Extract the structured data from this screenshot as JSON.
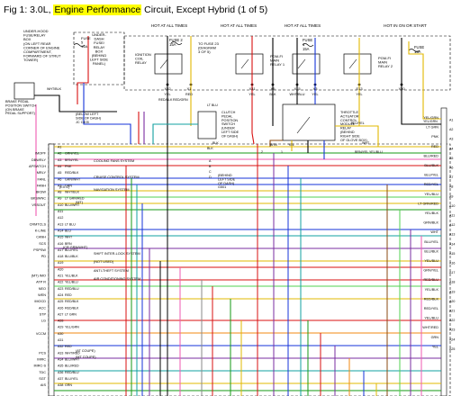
{
  "figure": {
    "title_prefix": "Fig 1: 3.0L, ",
    "title_highlight": "Engine Performance",
    "title_suffix": " Circuit, Except Hybrid (1 of 5)",
    "highlight_color": "#ffff00"
  },
  "power": {
    "hot_labels": [
      "HOT AT ALL TIMES",
      "HOT AT ALL TIMES",
      "HOT AT ALL TIMES",
      "HOT IN ON OR START"
    ],
    "fuse_box_underhood": [
      "UNDER-HOOD",
      "FUSE/RELAY",
      "BOX",
      "(ON LEFT REAR",
      "CORNER OF ENGINE",
      "COMPARTMENT,",
      "FORWARD OF STRUT",
      "TOWER)"
    ],
    "fuse_box_dash": [
      "UNDER-",
      "DASH",
      "FUSE/",
      "RELAY",
      "BOX",
      "(BEHIND",
      "LEFT SIDE",
      "PANEL)"
    ],
    "fuse5": [
      "FUSE",
      "5",
      "15A"
    ],
    "fuse2": [
      "FUSE 2",
      "15A"
    ],
    "fuse23": [
      "TO FUSE 23",
      "(DIAGRAM",
      "3 OF 5)"
    ],
    "fuse1": [
      "FUSE",
      "1",
      "15A"
    ],
    "fuse": [
      "FUSE",
      "15A"
    ],
    "ignition_coil_relay": [
      "IGNITION",
      "COIL",
      "RELAY"
    ],
    "pgm_fi_relay_1": [
      "PGM-FI",
      "MAIN",
      "RELAY 1"
    ],
    "pgm_fi_relay_2": [
      "PGM-FI",
      "MAIN",
      "RELAY 2"
    ]
  },
  "connectors": [
    {
      "pin": "X32",
      "wire": "YEL"
    },
    {
      "pin": "X1",
      "wire": "RED"
    },
    {
      "pin": "X31",
      "wire": "YEL"
    },
    {
      "pin": "X5",
      "wire": "BLK"
    },
    {
      "pin": "X15",
      "wire": "WHT/BLU"
    },
    {
      "pin": "X3",
      "wire": "YEL"
    },
    {
      "pin": "E13",
      "wire": "YEL"
    },
    {
      "pin": "X30",
      "wire": ""
    }
  ],
  "relays": {
    "brake_switch": [
      "BRAKE PEDAL",
      "POSITION SWITCH",
      "(ON BRAKE",
      "PEDAL SUPPORT)"
    ],
    "below_dash": [
      "(BELOW LEFT",
      "SIDE OF DASH)",
      "JC C405"
    ],
    "clutch_switch": [
      "CLUTCH",
      "PEDAL",
      "POSITION",
      "SWITCH",
      "(UNDER",
      "LEFT SIDE",
      "OF DASH)"
    ],
    "throttle_relay": [
      "THROTTLE",
      "ACTUATOR",
      "CONTROL",
      "MODULE",
      "RELAY",
      "(BEHIND",
      "RIGHT SIDE",
      "OF GLOVE BOX)"
    ],
    "ground": [
      "(BEHIND",
      "LEFT SIDE",
      "OF DASH)",
      "G501"
    ],
    "misc": [
      "LT BLU",
      "BLK",
      "BLU/YEL",
      "YEL/GRN",
      "WHT/BLK",
      "2",
      "1",
      "A",
      "B",
      "C",
      "D",
      "RED/BLK",
      "RED/GRN",
      "BRN",
      "YEL",
      "BLK",
      "WHT",
      "BRN/YEL",
      "YEL/BLU"
    ]
  },
  "ecm_left": [
    {
      "pin": "A1",
      "wire": "",
      "signal": ""
    },
    {
      "pin": "A2",
      "wire": "GRN/YEL",
      "signal": "IMOPF"
    },
    {
      "pin": "A3",
      "wire": "BRN/YEL",
      "signal": "DBWRLY"
    },
    {
      "pin": "A4",
      "wire": "PNK",
      "signal": "APSWTCH"
    },
    {
      "pin": "A5",
      "wire": "RED/BLK",
      "signal": "MRLY"
    },
    {
      "pin": "A6",
      "wire": "GRN/WHT",
      "signal": "FANL"
    },
    {
      "pin": "A7",
      "wire": "GRN",
      "signal": "FANH"
    },
    {
      "pin": "A8",
      "wire": "WHT/BLK",
      "signal": "BKSW"
    },
    {
      "pin": "A9",
      "wire": "LT GRN/RED",
      "signal": "BKSWNC"
    },
    {
      "pin": "A10",
      "wire": "BLU/WHT",
      "signal": "VSSOUT"
    },
    {
      "pin": "A11",
      "wire": "",
      "signal": ""
    },
    {
      "pin": "A12",
      "wire": "",
      "signal": ""
    },
    {
      "pin": "A13",
      "wire": "LT BLU",
      "signal": "CRMTCLS"
    },
    {
      "pin": "A14",
      "wire": "BLU",
      "signal": "K-LINE"
    },
    {
      "pin": "A15",
      "wire": "WHT",
      "signal": "CANH"
    },
    {
      "pin": "A16",
      "wire": "BRN",
      "signal": "SCS"
    },
    {
      "pin": "A17",
      "wire": "BLU/YEL",
      "signal": "PSPSW"
    },
    {
      "pin": "A18",
      "wire": "BLU/BLK",
      "signal": "PD"
    },
    {
      "pin": "A19",
      "wire": "",
      "signal": ""
    },
    {
      "pin": "A20",
      "wire": "",
      "signal": ""
    },
    {
      "pin": "A21",
      "wire": "YEL/BLK",
      "signal": "(MT) IMO"
    },
    {
      "pin": "A22",
      "wire": "YEL/BLU",
      "signal": "ATP R"
    },
    {
      "pin": "A23",
      "wire": "RED/BLU",
      "signal": "NEO"
    },
    {
      "pin": "A24",
      "wire": "RED",
      "signal": "WEN"
    },
    {
      "pin": "A25",
      "wire": "RED/BLK",
      "signal": "IMOCD"
    },
    {
      "pin": "A26",
      "wire": "RED/BLK",
      "signal": "ACC"
    },
    {
      "pin": "A27",
      "wire": "LT GRN",
      "signal": "STP"
    },
    {
      "pin": "A28",
      "wire": "",
      "signal": "LG"
    },
    {
      "pin": "A29",
      "wire": "YEL/GRN",
      "signal": ""
    },
    {
      "pin": "A30",
      "wire": "",
      "signal": "VCCM"
    },
    {
      "pin": "A31",
      "wire": "",
      "signal": ""
    },
    {
      "pin": "A32",
      "wire": "RED",
      "signal": ""
    },
    {
      "pin": "A33",
      "wire": "WHT/RED",
      "signal": "PCS"
    },
    {
      "pin": "A34",
      "wire": "BLU/WHT",
      "signal": "IMRC"
    },
    {
      "pin": "A35",
      "wire": "BLU/RED",
      "signal": "IMRC-S"
    },
    {
      "pin": "A36",
      "wire": "RED/BLU",
      "signal": "TDC"
    },
    {
      "pin": "A37",
      "wire": "BLU/YEL",
      "signal": "SGT"
    },
    {
      "pin": "A38",
      "wire": "GRN",
      "signal": "AIS"
    }
  ],
  "ecm_right": [
    {
      "pin": "A1",
      "wire": "YEL/GRN"
    },
    {
      "pin": "A2",
      "wire": "LT GRN"
    },
    {
      "pin": "A3",
      "wire": "PNK"
    },
    {
      "pin": "A4",
      "wire": "RED"
    },
    {
      "pin": "A5",
      "wire": "BLU/RED"
    },
    {
      "pin": "A6",
      "wire": "BLU/BLK"
    },
    {
      "pin": "A7",
      "wire": "BLU/YEL"
    },
    {
      "pin": "A8",
      "wire": "RED/YEL"
    },
    {
      "pin": "A9",
      "wire": "YEL/BLU"
    },
    {
      "pin": "A10",
      "wire": "LT GRN/RED"
    },
    {
      "pin": "A11",
      "wire": "YEL/BLK"
    },
    {
      "pin": "A12",
      "wire": "GRN/BLK"
    },
    {
      "pin": "A13",
      "wire": "WHT"
    },
    {
      "pin": "A14",
      "wire": "BLU/YEL"
    },
    {
      "pin": "A15",
      "wire": "BLU/BLK"
    },
    {
      "pin": "A16",
      "wire": "YEL/BLU"
    },
    {
      "pin": "A17",
      "wire": "GRN/YEL"
    },
    {
      "pin": "A18",
      "wire": "RED/BLU"
    },
    {
      "pin": "A19",
      "wire": "YEL/BLK"
    },
    {
      "pin": "A20",
      "wire": "RED/BLK"
    },
    {
      "pin": "A21",
      "wire": "RED/YEL"
    },
    {
      "pin": "A22",
      "wire": "YEL/BLU"
    },
    {
      "pin": "A23",
      "wire": "WHT/RED"
    },
    {
      "pin": "A24",
      "wire": "GRN"
    },
    {
      "pin": "A25",
      "wire": "YEL"
    }
  ],
  "systems": [
    {
      "label": "COOLING FANS SYSTEM"
    },
    {
      "label": "CRUISE CONTROL SYSTEM"
    },
    {
      "label": "(EX-L)"
    },
    {
      "label": "NAVIGATION SYSTEM"
    },
    {
      "label": "(MT)"
    },
    {
      "label": "SHIFT INTER-LOCK SYSTEM"
    },
    {
      "label": "(NOT USED)"
    },
    {
      "label": "ANTI-THEFT SYSTEM"
    },
    {
      "label": "AIR CONDITIONING SYSTEM"
    },
    {
      "label": "(AT COUPE)"
    },
    {
      "label": "(MT COUPE)"
    },
    {
      "label": "(CR GRN/WHT)"
    }
  ],
  "wire_colors": {
    "red": "#d81010",
    "green": "#169a16",
    "blue": "#1533d8",
    "yellow": "#e2b800",
    "pink": "#ef5ab0",
    "lightgreen": "#52d252",
    "orange": "#f08a10",
    "purple": "#7a2ca0",
    "teal": "#12a0a0",
    "brown": "#8a4a12",
    "black": "#000000",
    "gray": "#8a8a8a"
  }
}
